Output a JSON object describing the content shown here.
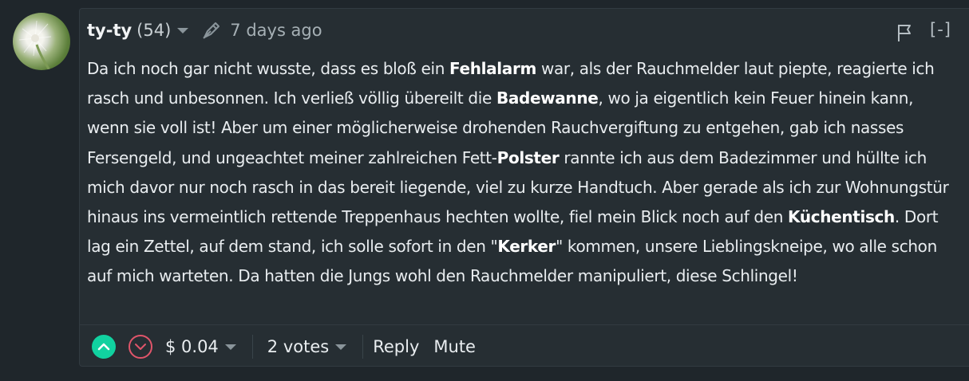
{
  "comment": {
    "author": "ty-ty",
    "reputation": "(54)",
    "timestamp": "7 days ago",
    "collapse_label": "[-]",
    "body_paragraphs": [
      [
        {
          "text": "Da ich noch gar nicht wusste, dass es bloß ein "
        },
        {
          "text": "Fehlalarm",
          "bold": true
        },
        {
          "text": " war, als der Rauchmelder laut piepte, reagierte ich rasch und unbesonnen. Ich verließ völlig übereilt die "
        },
        {
          "text": "Badewanne",
          "bold": true
        },
        {
          "text": ", wo ja eigentlich kein Feuer hinein kann, wenn sie voll ist! Aber um einer möglicherweise drohenden Rauchvergiftung zu entgehen, gab ich nasses Fersengeld, und ungeachtet meiner zahlreichen Fett-"
        },
        {
          "text": "Polster",
          "bold": true
        },
        {
          "text": " rannte ich aus dem Badezimmer und hüllte ich mich davor nur noch rasch in das bereit liegende, viel zu kurze Handtuch. Aber gerade als ich zur Wohnungstür hinaus ins vermeintlich rettende Treppenhaus hechten wollte, fiel mein Blick noch auf den "
        },
        {
          "text": "Küchentisch",
          "bold": true
        },
        {
          "text": ". Dort lag ein Zettel, auf dem stand, ich solle sofort in den \""
        },
        {
          "text": "Kerker",
          "bold": true
        },
        {
          "text": "\" kommen, unsere Lieblingskneipe, wo alle schon auf mich warteten. Da hatten die Jungs wohl den Rauchmelder manipuliert, diese Schlingel!"
        }
      ]
    ]
  },
  "footer": {
    "payout": "$ 0.04",
    "votes": "2 votes",
    "reply_label": "Reply",
    "mute_label": "Mute"
  },
  "icons": {
    "upvote": "chevron-up-icon",
    "downvote": "chevron-down-icon",
    "edit": "pencil-icon",
    "flag": "flag-icon"
  },
  "colors": {
    "background": "#1f262b",
    "card": "#262e33",
    "upvote": "#11d1a0",
    "downvote": "#e0556a"
  }
}
